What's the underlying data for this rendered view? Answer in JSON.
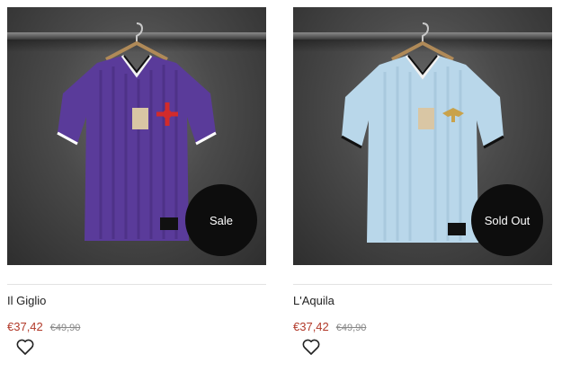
{
  "products": [
    {
      "name": "Il Giglio",
      "price": "€37,42",
      "old_price": "€49,90",
      "badge": "Sale",
      "shirt_color": "#5a3b9a",
      "shirt_emblem": "red-cross-lily"
    },
    {
      "name": "L'Aquila",
      "price": "€37,42",
      "old_price": "€49,90",
      "badge": "Sold Out",
      "shirt_color": "#b9d7ea",
      "shirt_emblem": "gold-eagle"
    }
  ],
  "colors": {
    "price": "#b23a2a",
    "badge_bg": "#0d0d0d",
    "background": "#4a4a4a"
  },
  "icons": {
    "wishlist": "heart-outline-icon"
  }
}
